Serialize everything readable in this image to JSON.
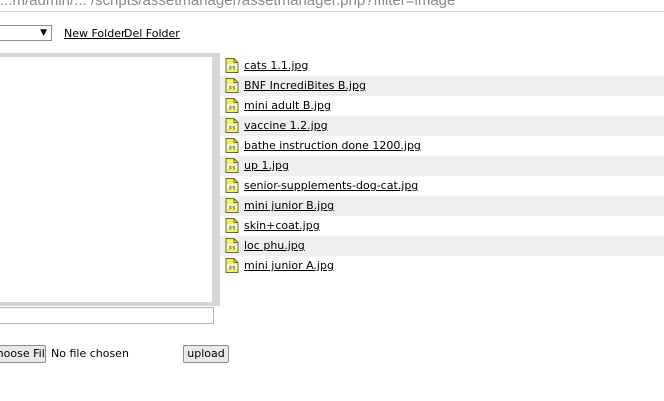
{
  "browser": {
    "url": "...m/admin/... /scripts/assetmanager/assetmanager.php?ffilter=image"
  },
  "toolbar": {
    "folder_select_value": "",
    "new_folder_label": "New Folder",
    "del_folder_label": "Del Folder"
  },
  "files": [
    {
      "name": "cats 1.1.jpg"
    },
    {
      "name": "BNF IncrediBites B.jpg"
    },
    {
      "name": "mini adult B.jpg"
    },
    {
      "name": "vaccine 1.2.jpg"
    },
    {
      "name": "bathe instruction done 1200.jpg"
    },
    {
      "name": "up 1.jpg"
    },
    {
      "name": "senior-supplements-dog-cat.jpg"
    },
    {
      "name": "mini junior B.jpg"
    },
    {
      "name": "skin+coat.jpg"
    },
    {
      "name": "loc phu.jpg"
    },
    {
      "name": "mini junior A.jpg"
    }
  ],
  "upload": {
    "choose_file_label": "Choose File",
    "no_file_label": "No file chosen",
    "upload_label": "upload"
  },
  "icons": {
    "file": "jpg-file-icon",
    "dropdown": "chevron-down-icon"
  },
  "colors": {
    "row_alt": "#efefef",
    "pane_border": "#d6d6d6",
    "icon_yellow": "#f2f06a"
  }
}
